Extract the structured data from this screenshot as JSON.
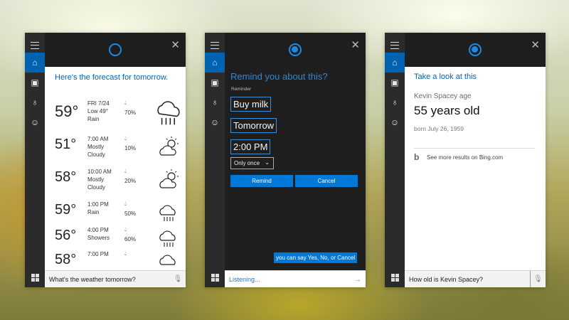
{
  "panel_weather": {
    "title": "Here's the forecast for tomorrow.",
    "rows": [
      {
        "temp": "59°",
        "time": "FRI 7/24",
        "sub1": "Low 49°",
        "sub2": "Rain",
        "pct": "70%",
        "icon": "rain-cloud-icon"
      },
      {
        "temp": "51°",
        "time": "7:00 AM",
        "sub1": "Mostly",
        "sub2": "Cloudy",
        "pct": "10%",
        "icon": "partly-cloudy-icon"
      },
      {
        "temp": "58°",
        "time": "10:00 AM",
        "sub1": "Mostly",
        "sub2": "Cloudy",
        "pct": "20%",
        "icon": "partly-cloudy-icon"
      },
      {
        "temp": "59°",
        "time": "1:00 PM",
        "sub1": "Rain",
        "sub2": "",
        "pct": "50%",
        "icon": "rain-cloud-icon"
      },
      {
        "temp": "56°",
        "time": "4:00 PM",
        "sub1": "Showers",
        "sub2": "",
        "pct": "60%",
        "icon": "rain-cloud-icon"
      },
      {
        "temp": "58°",
        "time": "7:00 PM",
        "sub1": "",
        "sub2": "",
        "pct": "",
        "icon": "rain-cloud-icon"
      }
    ],
    "query": "What's the weather tomorrow?"
  },
  "panel_reminder": {
    "question": "Remind you about this?",
    "label": "Reminder",
    "subject": "Buy milk",
    "day": "Tomorrow",
    "time": "2:00 PM",
    "repeat": "Only once",
    "remind_button": "Remind",
    "cancel_button": "Cancel",
    "hint": "you can say Yes, No, or Cancel",
    "status": "Listening..."
  },
  "panel_answer": {
    "heading": "Take a look at this",
    "question": "Kevin Spacey age",
    "answer": "55 years old",
    "detail": "born July 26, 1959",
    "more": "See more results on Bing.com",
    "query": "How old is Kevin Spacey?"
  },
  "colors": {
    "accent": "#0078d7",
    "cortana": "#1e88e5",
    "rail": "#2b2b2b"
  }
}
